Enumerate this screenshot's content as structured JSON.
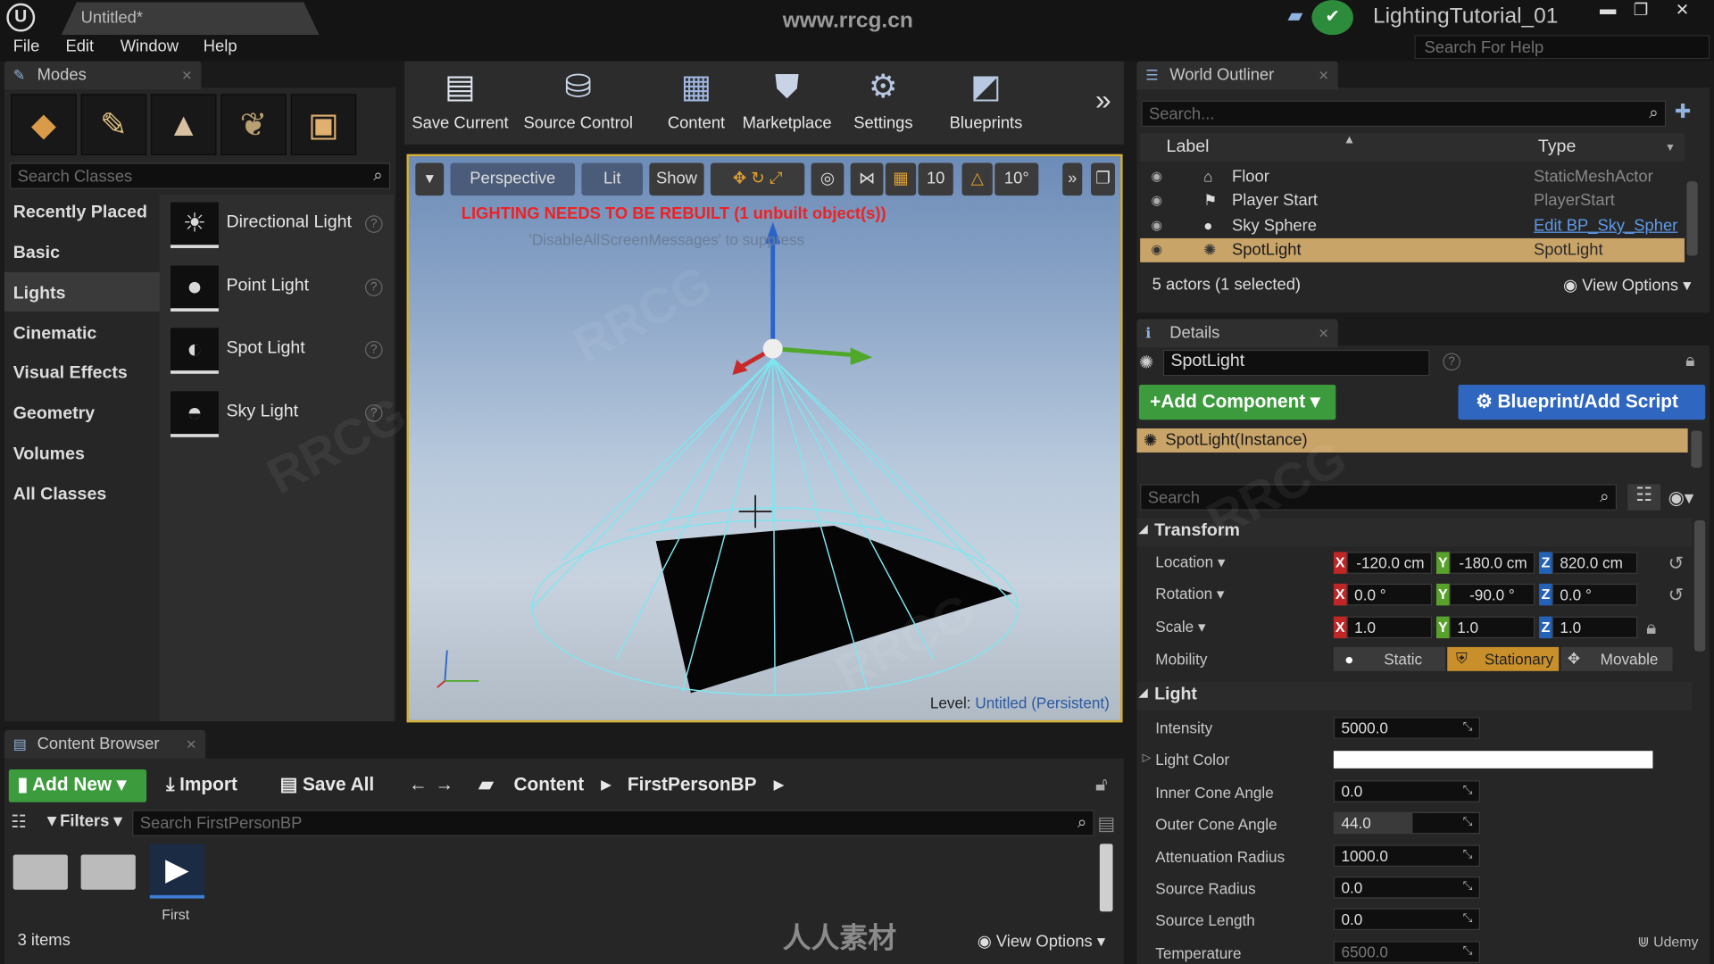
{
  "titlebar": {
    "tab": "Untitled*",
    "watermark_url": "www.rrcg.cn",
    "project": "LightingTutorial_01"
  },
  "menu": {
    "items": [
      "File",
      "Edit",
      "Window",
      "Help"
    ],
    "help_search_placeholder": "Search For Help"
  },
  "modes": {
    "tab": "Modes",
    "search_placeholder": "Search Classes",
    "categories": [
      "Recently Placed",
      "Basic",
      "Lights",
      "Cinematic",
      "Visual Effects",
      "Geometry",
      "Volumes",
      "All Classes"
    ],
    "selected_category": "Lights",
    "items": [
      {
        "label": "Directional Light",
        "icon": "directional-light-icon"
      },
      {
        "label": "Point Light",
        "icon": "point-light-icon"
      },
      {
        "label": "Spot Light",
        "icon": "spot-light-icon"
      },
      {
        "label": "Sky Light",
        "icon": "sky-light-icon"
      }
    ]
  },
  "toolbar": {
    "save": "Save Current",
    "source": "Source Control",
    "content": "Content",
    "marketplace": "Marketplace",
    "settings": "Settings",
    "blueprints": "Blueprints"
  },
  "viewport": {
    "perspective": "Perspective",
    "lit": "Lit",
    "show": "Show",
    "grid_snap": "10",
    "rot_snap": "10°",
    "warning": "LIGHTING NEEDS TO BE REBUILT (1 unbuilt object(s))",
    "suppress": "'DisableAllScreenMessages' to suppress",
    "level_label": "Level:",
    "level_name": "Untitled (Persistent)"
  },
  "outliner": {
    "tab": "World Outliner",
    "search_placeholder": "Search...",
    "col_label": "Label",
    "col_type": "Type",
    "rows": [
      {
        "label": "Floor",
        "type": "StaticMeshActor"
      },
      {
        "label": "Player Start",
        "type": "PlayerStart"
      },
      {
        "label": "Sky Sphere",
        "type": "Edit BP_Sky_Spher"
      },
      {
        "label": "SpotLight",
        "type": "SpotLight"
      }
    ],
    "summary": "5 actors (1 selected)",
    "view_options": "View Options"
  },
  "details": {
    "tab": "Details",
    "name": "SpotLight",
    "add_component": "Add Component",
    "blueprint": "Blueprint/Add Script",
    "instance": "SpotLight(Instance)",
    "search_placeholder": "Search",
    "transform": {
      "title": "Transform",
      "location_label": "Location",
      "location": [
        "-120.0 cm",
        "-180.0 cm",
        "820.0 cm"
      ],
      "rotation_label": "Rotation",
      "rotation": [
        "0.0 °",
        "-90.0 °",
        "0.0 °"
      ],
      "scale_label": "Scale",
      "scale": [
        "1.0",
        "1.0",
        "1.0"
      ],
      "mobility_label": "Mobility",
      "mobility": [
        "Static",
        "Stationary",
        "Movable"
      ]
    },
    "light": {
      "title": "Light",
      "props": [
        {
          "label": "Intensity",
          "value": "5000.0"
        },
        {
          "label": "Light Color",
          "value": ""
        },
        {
          "label": "Inner Cone Angle",
          "value": "0.0"
        },
        {
          "label": "Outer Cone Angle",
          "value": "44.0"
        },
        {
          "label": "Attenuation Radius",
          "value": "1000.0"
        },
        {
          "label": "Source Radius",
          "value": "0.0"
        },
        {
          "label": "Source Length",
          "value": "0.0"
        },
        {
          "label": "Temperature",
          "value": "6500.0"
        }
      ]
    }
  },
  "content_browser": {
    "tab": "Content Browser",
    "add_new": "Add New",
    "import": "Import",
    "save_all": "Save All",
    "path": [
      "Content",
      "FirstPersonBP"
    ],
    "filters": "Filters",
    "search_placeholder": "Search FirstPersonBP",
    "asset_label": "First",
    "count": "3 items",
    "view_options": "View Options"
  },
  "watermarks": {
    "bottom": "人人素材",
    "udemy": "Udemy"
  },
  "colors": {
    "selection": "#c9a469",
    "viewport_border": "#d6b23a",
    "add_green": "#3c9b3c",
    "blueprint_blue": "#2f66c0"
  }
}
